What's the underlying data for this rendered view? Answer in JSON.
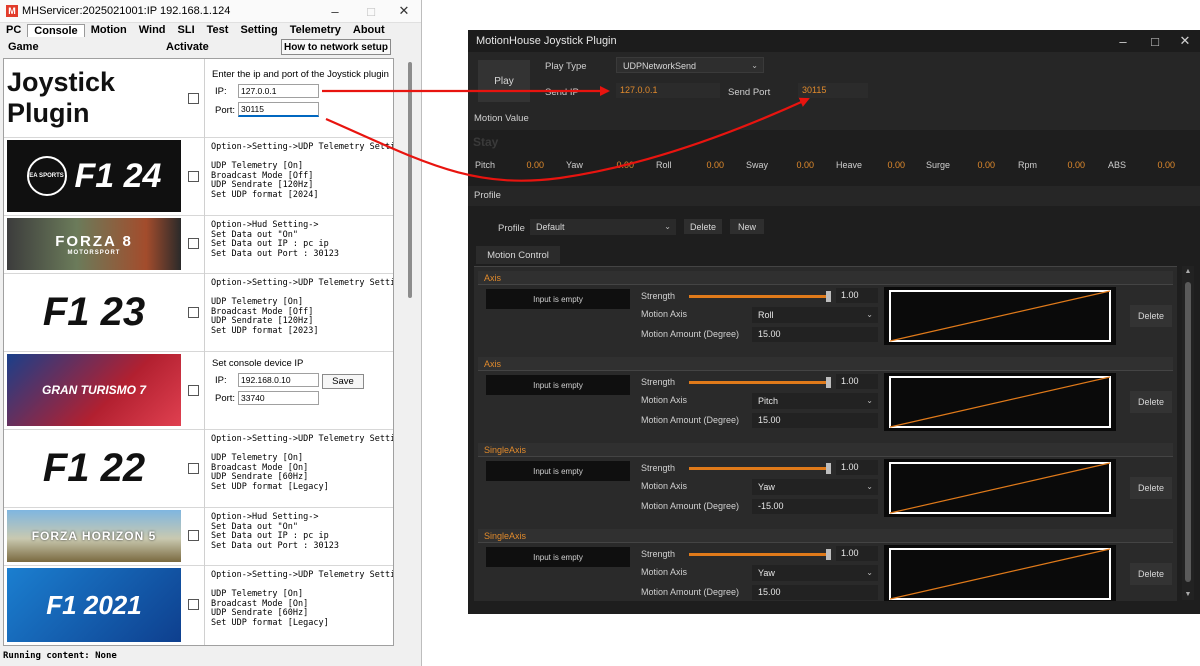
{
  "left_window": {
    "title": "MHServicer:20250210​01:IP 192.168.1.124",
    "app_icon": "M",
    "menu": [
      "PC",
      "Console",
      "Motion",
      "Wind",
      "SLI",
      "Test",
      "Setting",
      "Telemetry",
      "About"
    ],
    "active_menu": "Console",
    "sub": {
      "game": "Game",
      "activate": "Activate",
      "howto": "How to network setup"
    },
    "games": [
      {
        "logo": "Joystick Plugin",
        "intro": "Enter the ip and port of the Joystick plugin",
        "ip_label": "IP:",
        "ip": "127.0.0.1",
        "port_label": "Port:",
        "port": "30115"
      },
      {
        "logo_left": "EA SPORTS",
        "logo": "F1 24",
        "text": "Option->Setting->UDP Telemetry Setting\n\nUDP Telemetry [On]\nBroadcast Mode [Off]\nUDP Sendrate [120Hz]\nSet UDP format [2024]"
      },
      {
        "logo": "FORZA 8",
        "logo_sub": "MOTORSPORT",
        "text": "Option->Hud Setting->\nSet Data out \"On\"\nSet Data out IP : pc ip\nSet Data out Port : 30123"
      },
      {
        "logo": "F1 23",
        "text": "Option->Setting->UDP Telemetry Setting\n\nUDP Telemetry [On]\nBroadcast Mode [Off]\nUDP Sendrate [120Hz]\nSet UDP format [2023]"
      },
      {
        "logo": "GRAN TURISMO 7",
        "intro": "Set console device IP",
        "ip_label": "IP:",
        "ip": "192.168.0.10",
        "port_label": "Port:",
        "port": "33740",
        "save": "Save"
      },
      {
        "logo": "F1 22",
        "text": "Option->Setting->UDP Telemetry Setting\n\nUDP Telemetry [On]\nBroadcast Mode [On]\nUDP Sendrate [60Hz]\nSet UDP format [Legacy]"
      },
      {
        "logo": "FORZA HORIZON 5",
        "text": "Option->Hud Setting->\nSet Data out \"On\"\nSet Data out IP : pc ip\nSet Data out Port : 30123"
      },
      {
        "logo": "F1 2021",
        "text": "Option->Setting->UDP Telemetry Setting\n\nUDP Telemetry [On]\nBroadcast Mode [On]\nUDP Sendrate [60Hz]\nSet UDP format [Legacy]"
      }
    ],
    "status": "Running content: None"
  },
  "right_window": {
    "title": "MotionHouse Joystick Plugin",
    "play": "Play",
    "play_type_label": "Play Type",
    "play_type": "UDPNetworkSend",
    "send_ip_label": "Send IP",
    "send_ip": "127.0.0.1",
    "send_port_label": "Send Port",
    "send_port": "30115",
    "motion_value_label": "Motion Value",
    "state": "Stay",
    "motion_values": [
      {
        "label": "Pitch",
        "value": "0.00"
      },
      {
        "label": "Yaw",
        "value": "0.00"
      },
      {
        "label": "Roll",
        "value": "0.00"
      },
      {
        "label": "Sway",
        "value": "0.00"
      },
      {
        "label": "Heave",
        "value": "0.00"
      },
      {
        "label": "Surge",
        "value": "0.00"
      },
      {
        "label": "Rpm",
        "value": "0.00"
      },
      {
        "label": "ABS",
        "value": "0.00"
      }
    ],
    "profile_section": "Profile",
    "profile_label": "Profile",
    "profile": "Default",
    "delete": "Delete",
    "new": "New",
    "motion_control_tab": "Motion Control",
    "axes": [
      {
        "type": "Axis",
        "input": "Input is empty",
        "strength_label": "Strength",
        "strength": "1.00",
        "axis_label": "Motion Axis",
        "axis": "Roll",
        "amount_label": "Motion Amount (Degree)",
        "amount": "15.00",
        "delete": "Delete"
      },
      {
        "type": "Axis",
        "input": "Input is empty",
        "strength_label": "Strength",
        "strength": "1.00",
        "axis_label": "Motion Axis",
        "axis": "Pitch",
        "amount_label": "Motion Amount (Degree)",
        "amount": "15.00",
        "delete": "Delete"
      },
      {
        "type": "SingleAxis",
        "input": "Input is empty",
        "strength_label": "Strength",
        "strength": "1.00",
        "axis_label": "Motion Axis",
        "axis": "Yaw",
        "amount_label": "Motion Amount (Degree)",
        "amount": "-15.00",
        "delete": "Delete"
      },
      {
        "type": "SingleAxis",
        "input": "Input is empty",
        "strength_label": "Strength",
        "strength": "1.00",
        "axis_label": "Motion Axis",
        "axis": "Yaw",
        "amount_label": "Motion Amount (Degree)",
        "amount": "15.00",
        "delete": "Delete"
      }
    ]
  },
  "colors": {
    "accent_orange": "#e07a1a",
    "arrow_red": "#e8140f",
    "dark_bg": "#1e1e1e"
  }
}
